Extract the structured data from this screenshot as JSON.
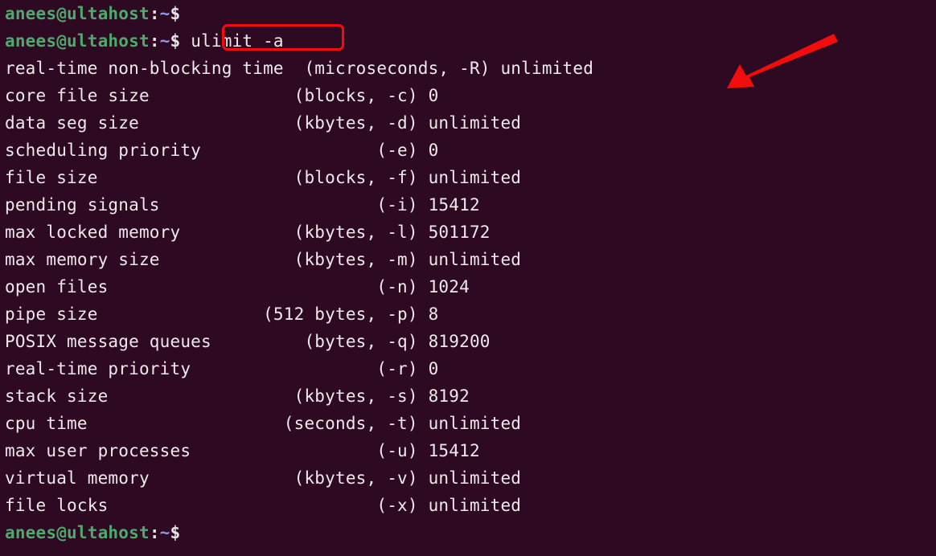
{
  "terminal": {
    "background_color": "#2d0922",
    "foreground_color": "#efe9ec",
    "prompt": {
      "user_host": "anees@ultahost",
      "colon": ":",
      "path": "~",
      "dollar": "$",
      "user_host_color": "#4fa86d",
      "path_color": "#8a9ae8"
    },
    "command": "ulimit -a",
    "lines": [
      {
        "type": "prompt",
        "command": ""
      },
      {
        "type": "prompt",
        "command": "ulimit -a",
        "highlighted": true
      },
      {
        "type": "output",
        "text": "real-time non-blocking time  (microseconds, -R) unlimited"
      },
      {
        "type": "output",
        "text": "core file size              (blocks, -c) 0"
      },
      {
        "type": "output",
        "text": "data seg size               (kbytes, -d) unlimited"
      },
      {
        "type": "output",
        "text": "scheduling priority                 (-e) 0"
      },
      {
        "type": "output",
        "text": "file size                   (blocks, -f) unlimited"
      },
      {
        "type": "output",
        "text": "pending signals                     (-i) 15412"
      },
      {
        "type": "output",
        "text": "max locked memory           (kbytes, -l) 501172"
      },
      {
        "type": "output",
        "text": "max memory size             (kbytes, -m) unlimited"
      },
      {
        "type": "output",
        "text": "open files                          (-n) 1024"
      },
      {
        "type": "output",
        "text": "pipe size                (512 bytes, -p) 8"
      },
      {
        "type": "output",
        "text": "POSIX message queues         (bytes, -q) 819200"
      },
      {
        "type": "output",
        "text": "real-time priority                  (-r) 0"
      },
      {
        "type": "output",
        "text": "stack size                  (kbytes, -s) 8192"
      },
      {
        "type": "output",
        "text": "cpu time                   (seconds, -t) unlimited"
      },
      {
        "type": "output",
        "text": "max user processes                  (-u) 15412"
      },
      {
        "type": "output",
        "text": "virtual memory              (kbytes, -v) unlimited"
      },
      {
        "type": "output",
        "text": "file locks                          (-x) unlimited"
      },
      {
        "type": "prompt",
        "command": ""
      }
    ]
  },
  "ulimit_table": {
    "rows": [
      {
        "resource": "real-time non-blocking time",
        "unit": "microseconds",
        "flag": "-R",
        "value": "unlimited"
      },
      {
        "resource": "core file size",
        "unit": "blocks",
        "flag": "-c",
        "value": "0"
      },
      {
        "resource": "data seg size",
        "unit": "kbytes",
        "flag": "-d",
        "value": "unlimited"
      },
      {
        "resource": "scheduling priority",
        "unit": "",
        "flag": "-e",
        "value": "0"
      },
      {
        "resource": "file size",
        "unit": "blocks",
        "flag": "-f",
        "value": "unlimited"
      },
      {
        "resource": "pending signals",
        "unit": "",
        "flag": "-i",
        "value": "15412"
      },
      {
        "resource": "max locked memory",
        "unit": "kbytes",
        "flag": "-l",
        "value": "501172"
      },
      {
        "resource": "max memory size",
        "unit": "kbytes",
        "flag": "-m",
        "value": "unlimited"
      },
      {
        "resource": "open files",
        "unit": "",
        "flag": "-n",
        "value": "1024"
      },
      {
        "resource": "pipe size",
        "unit": "512 bytes",
        "flag": "-p",
        "value": "8"
      },
      {
        "resource": "POSIX message queues",
        "unit": "bytes",
        "flag": "-q",
        "value": "819200"
      },
      {
        "resource": "real-time priority",
        "unit": "",
        "flag": "-r",
        "value": "0"
      },
      {
        "resource": "stack size",
        "unit": "kbytes",
        "flag": "-s",
        "value": "8192"
      },
      {
        "resource": "cpu time",
        "unit": "seconds",
        "flag": "-t",
        "value": "unlimited"
      },
      {
        "resource": "max user processes",
        "unit": "",
        "flag": "-u",
        "value": "15412"
      },
      {
        "resource": "virtual memory",
        "unit": "kbytes",
        "flag": "-v",
        "value": "unlimited"
      },
      {
        "resource": "file locks",
        "unit": "",
        "flag": "-x",
        "value": "unlimited"
      }
    ]
  },
  "annotations": {
    "command_box": {
      "color": "#f20d0d",
      "target": "ulimit -a"
    },
    "arrow": {
      "color": "#f20d0d",
      "points_to": "first-output-line"
    }
  }
}
